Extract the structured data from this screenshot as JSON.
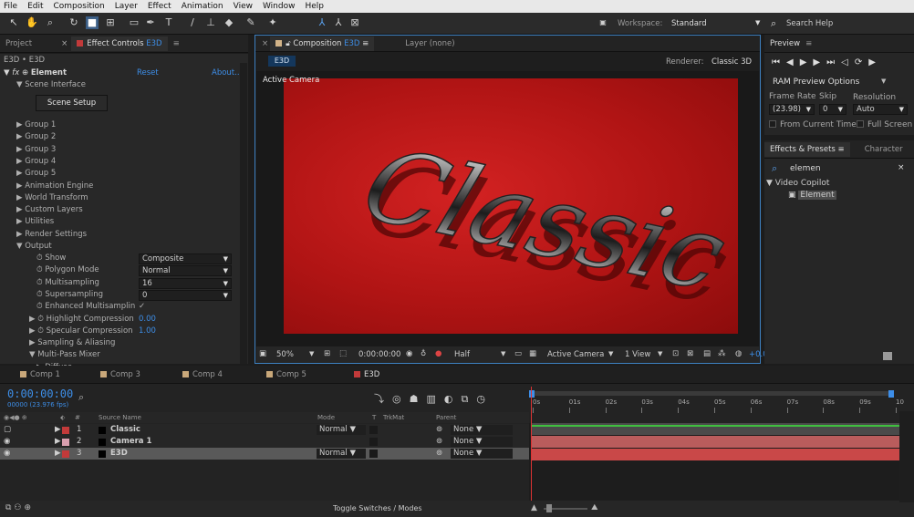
{
  "menu": [
    "File",
    "Edit",
    "Composition",
    "Layer",
    "Effect",
    "Animation",
    "View",
    "Window",
    "Help"
  ],
  "toolbar": {
    "workspace_label": "Workspace:",
    "workspace_value": "Standard",
    "search_help": "Search Help"
  },
  "left_panel": {
    "tabs": [
      "Project",
      "Effect Controls"
    ],
    "tab_suffix": "E3D",
    "breadcrumb": "E3D • E3D",
    "effect_name": "Element",
    "reset": "Reset",
    "about": "About...",
    "scene_interface": "Scene Interface",
    "scene_setup": "Scene Setup",
    "groups": [
      "Group 1",
      "Group 2",
      "Group 3",
      "Group 4",
      "Group 5",
      "Animation Engine",
      "World Transform",
      "Custom Layers",
      "Utilities",
      "Render Settings",
      "Output"
    ],
    "output_props": [
      {
        "label": "Show",
        "value": "Composite",
        "type": "dropdown"
      },
      {
        "label": "Polygon Mode",
        "value": "Normal",
        "type": "dropdown"
      },
      {
        "label": "Multisampling",
        "value": "16",
        "type": "dropdown"
      },
      {
        "label": "Supersampling",
        "value": "0",
        "type": "dropdown"
      },
      {
        "label": "Enhanced Multisamplin",
        "value": "✓",
        "type": "check"
      },
      {
        "label": "Highlight Compression",
        "value": "0.00",
        "type": "number"
      },
      {
        "label": "Specular Compression",
        "value": "1.00",
        "type": "number"
      }
    ],
    "more_groups": [
      "Sampling & Aliasing",
      "Multi-Pass Mixer",
      "Diffuse"
    ]
  },
  "composition": {
    "tab": "Composition",
    "tab_suffix": "E3D",
    "layer_tab": "Layer (none)",
    "chip": "E3D",
    "renderer_label": "Renderer:",
    "renderer": "Classic 3D",
    "camera_label": "Active Camera",
    "viewer_text": "Classic",
    "footer": {
      "zoom": "50%",
      "time": "0:00:00:00",
      "resolution": "Half",
      "view": "Active Camera",
      "views": "1 View",
      "offset": "+0.0"
    }
  },
  "preview": {
    "title": "Preview",
    "ram_options": "RAM Preview Options",
    "frame_rate_label": "Frame Rate",
    "skip_label": "Skip",
    "resolution_label": "Resolution",
    "frame_rate": "(23.98)",
    "skip": "0",
    "resolution": "Auto",
    "from_current": "From Current Time",
    "full_screen": "Full Screen"
  },
  "effects": {
    "tabs": [
      "Effects & Presets",
      "Character"
    ],
    "search": "elemen",
    "category": "Video Copilot",
    "item": "Element"
  },
  "timeline": {
    "tabs": [
      "Comp 1",
      "Comp 3",
      "Comp 4",
      "Comp 5",
      "E3D"
    ],
    "timecode": "0:00:00:00",
    "fps": "00000 (23.976 fps)",
    "headers": {
      "source": "Source Name",
      "mode": "Mode",
      "t": "T",
      "trkmat": "TrkMat",
      "parent": "Parent",
      "num": "#"
    },
    "layers": [
      {
        "num": "1",
        "name": "Classic",
        "mode": "Normal",
        "parent": "None",
        "color": "#c23a3a"
      },
      {
        "num": "2",
        "name": "Camera 1",
        "mode": "",
        "parent": "None",
        "color": "#d9a0b0"
      },
      {
        "num": "3",
        "name": "E3D",
        "mode": "Normal",
        "parent": "None",
        "color": "#c23a3a"
      }
    ],
    "ruler": [
      "0s",
      "01s",
      "02s",
      "03s",
      "04s",
      "05s",
      "06s",
      "07s",
      "08s",
      "09s",
      "10"
    ],
    "toggle": "Toggle Switches / Modes"
  },
  "colors": {
    "accent": "#3d8ee8",
    "layer_bar": "#b95c5c",
    "layer_bar_selected": "#c94848",
    "green": "#3fbf3f"
  }
}
